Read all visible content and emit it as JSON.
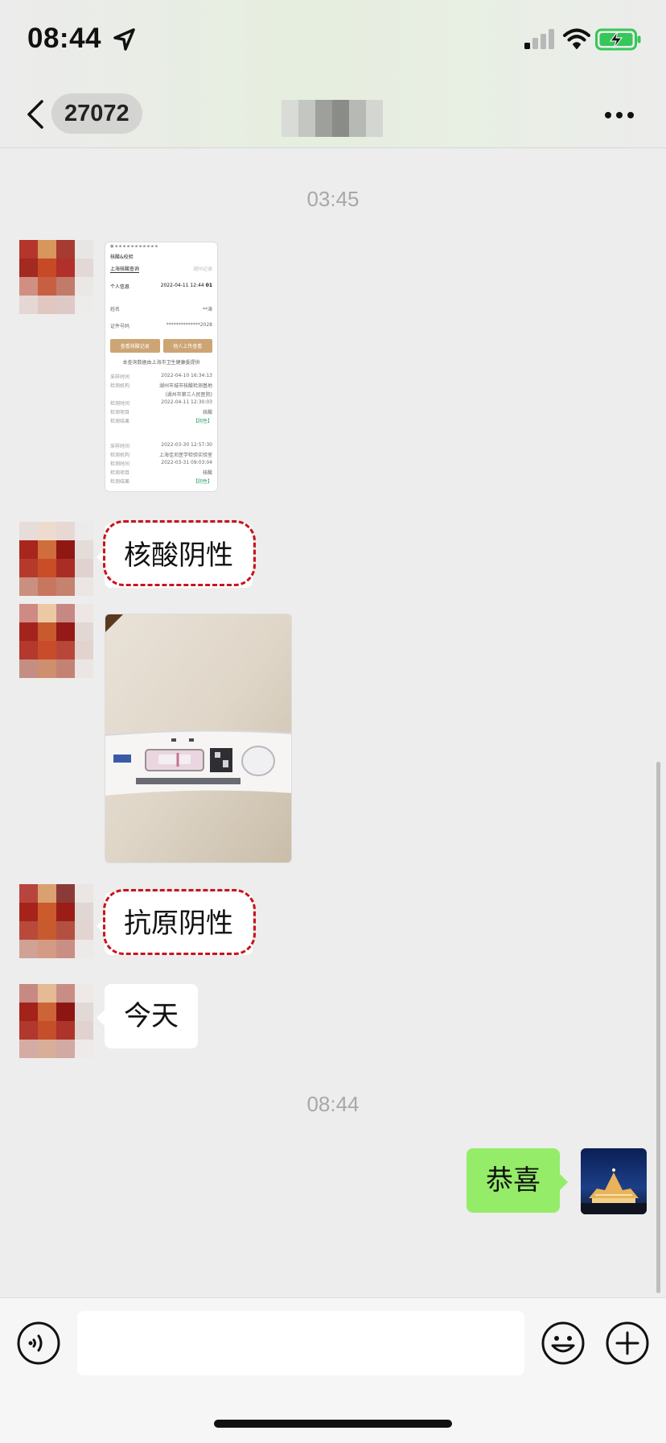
{
  "status_bar": {
    "time": "08:44",
    "icons": [
      "location-arrow-icon",
      "cellular-signal-icon",
      "wifi-icon",
      "battery-charging-icon"
    ],
    "battery_color": "#35c759"
  },
  "header": {
    "back_icon": "chevron-left-icon",
    "unread_count": "27072",
    "title_obscured": true,
    "more_icon": "more-dots-icon"
  },
  "messages": [
    {
      "kind": "timestamp",
      "text": "03:45"
    },
    {
      "kind": "image",
      "from": "contact",
      "description_icon": "screenshot-image",
      "screenshot_text": {
        "nav_title": "核酸&校验",
        "tab_active": "上海核酸查询",
        "tab_inactive": "湖州记录",
        "section": "个人信息",
        "date": "2022-04-11 12:44",
        "code": "01",
        "name_label": "姓名",
        "name_value": "**涛",
        "id_label": "证件号码",
        "id_value": "**************2028",
        "btn1": "查看核酸记录",
        "btn2": "他人上传查看",
        "notice": "本查询数据由上海市卫生健康委提供",
        "r1": [
          [
            "采样时间",
            "2022-04-10 16:34:13"
          ],
          [
            "检测机构",
            "湖州市城市核酸检测基地"
          ],
          [
            "",
            "(湖州市第三人民医院)"
          ],
          [
            "检测时间",
            "2022-04-11 12:30:03"
          ],
          [
            "检测项目",
            "核酸"
          ],
          [
            "检测结果",
            "【阴性】"
          ]
        ],
        "r2": [
          [
            "采样时间",
            "2022-03-30 12:57:30"
          ],
          [
            "检测机构",
            "上海佳尼医学检验实验室"
          ],
          [
            "检测时间",
            "2022-03-31 09:03:04"
          ],
          [
            "检测项目",
            "核酸"
          ],
          [
            "检测结果",
            "【阴性】"
          ]
        ]
      }
    },
    {
      "kind": "text",
      "from": "contact",
      "text": "核酸阴性",
      "highlight": "dashed-red"
    },
    {
      "kind": "image",
      "from": "contact",
      "description_icon": "antigen-test-photo"
    },
    {
      "kind": "text",
      "from": "contact",
      "text": "抗原阴性",
      "highlight": "dashed-red"
    },
    {
      "kind": "text",
      "from": "contact",
      "text": "今天"
    },
    {
      "kind": "timestamp",
      "text": "08:44"
    },
    {
      "kind": "text",
      "from": "me",
      "text": "恭喜"
    }
  ],
  "input_bar": {
    "voice_icon": "voice-input-icon",
    "text_value": "",
    "emoji_icon": "emoji-icon",
    "plus_icon": "plus-circle-icon"
  },
  "colors": {
    "background": "#ededed",
    "my_bubble": "#95ec69",
    "their_bubble": "#ffffff",
    "highlight_red": "#c8141c"
  }
}
